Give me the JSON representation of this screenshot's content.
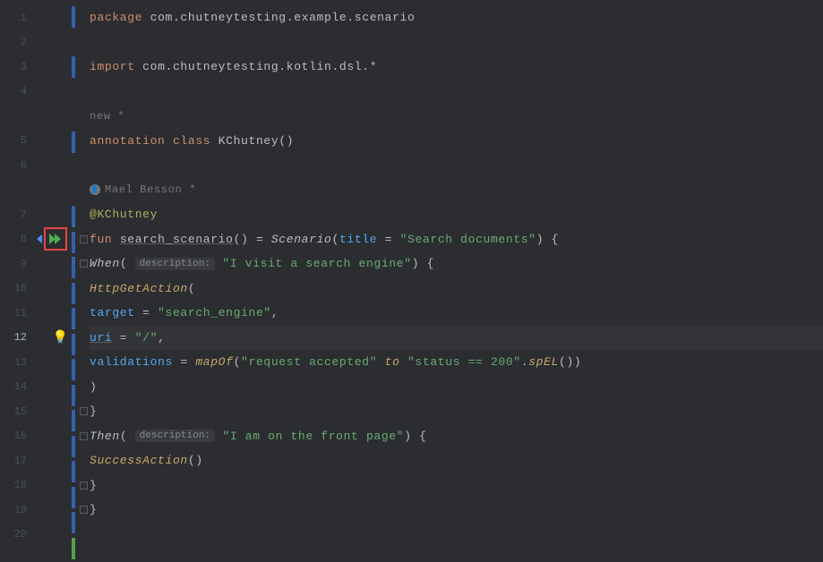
{
  "lines": [
    "1",
    "2",
    "3",
    "4",
    "5",
    "6",
    "7",
    "8",
    "9",
    "10",
    "11",
    "12",
    "13",
    "14",
    "15",
    "16",
    "17",
    "18",
    "19",
    "20"
  ],
  "currentLine": "12",
  "inlay_new": "new *",
  "inlay_author": "Mael Besson *",
  "hint_desc": "description:",
  "code": {
    "kw_package": "package",
    "pkg_name": " com.chutneytesting.example.scenario",
    "kw_import": "import",
    "import_name": " com.chutneytesting.kotlin.dsl.*",
    "kw_annotation": "annotation",
    "kw_class": "class",
    "cls_kchutney": "KChutney",
    "parens_empty": "()",
    "anno_kchutney": "@KChutney",
    "kw_fun": "fun",
    "fn_search_scenario": "search_scenario",
    "eq": "=",
    "fn_scenario": "Scenario",
    "lparen": "(",
    "rparen": ")",
    "param_title": "title",
    "str_search_docs": "\"Search documents\"",
    "brace_open": "{",
    "brace_close": "}",
    "fn_when": "When",
    "str_visit": "\"I visit a search engine\"",
    "fn_httpget": "HttpGetAction",
    "param_target": "target",
    "str_target": "\"search_engine\"",
    "comma": ",",
    "param_uri": "uri",
    "str_uri": "\"/\"",
    "param_validations": "validations",
    "fn_mapof": "mapOf",
    "str_req_accepted": "\"request accepted\"",
    "kw_to": "to",
    "str_status": "\"status == 200\"",
    "dot": ".",
    "fn_spel": "spEL",
    "fn_then": "Then",
    "str_front_page": "\"I am on the front page\"",
    "fn_success": "SuccessAction"
  }
}
